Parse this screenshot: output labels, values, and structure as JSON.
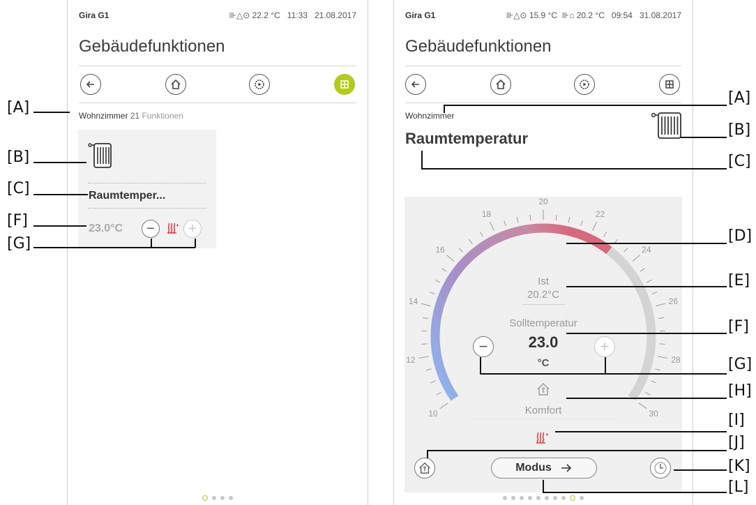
{
  "left_screen": {
    "device_name": "Gira G1",
    "status_icons": "⊪△⊙",
    "temperature": "22.2 °C",
    "time": "11:33",
    "date": "21.08.2017",
    "page_title": "Gebäudefunktionen",
    "room_name": "Wohnzimmer",
    "function_count": "21",
    "functions_label": "Funktionen",
    "tile": {
      "name": "Raumtemper...",
      "value": "23.0°C"
    },
    "page_dots": 4,
    "current_dot": 0
  },
  "right_screen": {
    "device_name": "Gira G1",
    "status_icons_1": "⊪△⊙",
    "outside_temperature": "15.9 °C",
    "status_icons_2": "⊪⌂",
    "inside_temperature": "20.2 °C",
    "time": "09:54",
    "date": "31.08.2017",
    "page_title": "Gebäudefunktionen",
    "room_name": "Wohnzimmer",
    "function_name": "Raumtemperatur",
    "dial": {
      "ticks": [
        "10",
        "12",
        "14",
        "16",
        "18",
        "20",
        "22",
        "24",
        "26",
        "28",
        "30"
      ],
      "ist_label": "Ist",
      "ist_value": "20.2°C",
      "setpoint_label": "Solltemperatur",
      "setpoint_value": "23.0",
      "setpoint_unit": "°C",
      "mode_label": "Komfort",
      "current_temp": 20.2,
      "setpoint": 23.0,
      "min": 10,
      "max": 30
    },
    "modus_label": "Modus",
    "page_dots": 10,
    "current_dot": 8
  },
  "callouts_left": [
    "[A]",
    "[B]",
    "[C]",
    "[F]",
    "[G]"
  ],
  "callouts_right": [
    "[A]",
    "[B]",
    "[C]",
    "[D]",
    "[E]",
    "[F]",
    "[G]",
    "[H]",
    "[I]",
    "[J]",
    "[K]",
    "[L]"
  ],
  "colors": {
    "accent": "#b2cc1a",
    "heat_red": "#e0262e"
  }
}
